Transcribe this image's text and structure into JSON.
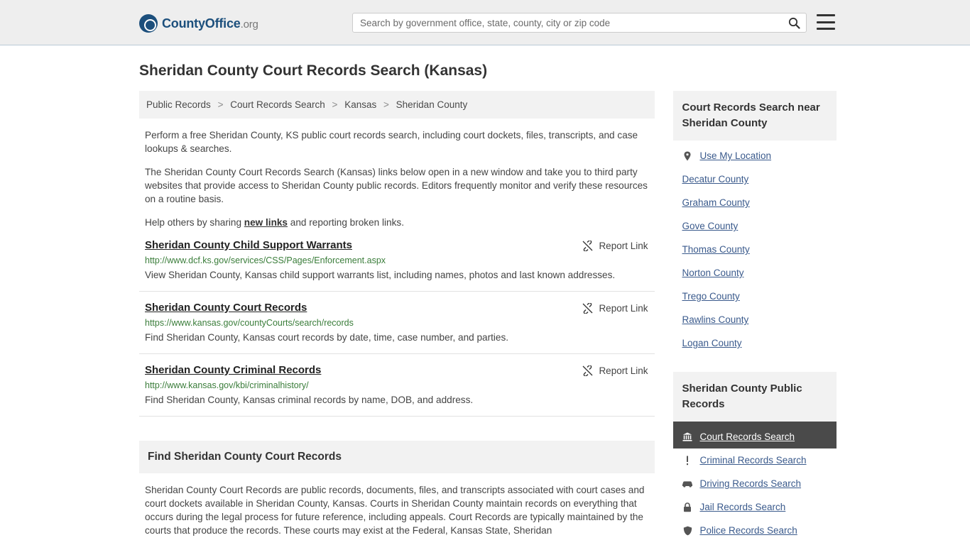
{
  "header": {
    "logo": {
      "county": "County",
      "office": "Office",
      "org": ".org"
    },
    "search": {
      "placeholder": "Search by government office, state, county, city or zip code",
      "value": "",
      "button_label": "search-icon"
    },
    "menu_label": "menu-icon"
  },
  "page_title": "Sheridan County Court Records Search (Kansas)",
  "breadcrumb": [
    "Public Records",
    "Court Records Search",
    "Kansas",
    "Sheridan County"
  ],
  "breadcrumb_separator": ">",
  "intro": {
    "p1": "Perform a free Sheridan County, KS public court records search, including court dockets, files, transcripts, and case lookups & searches.",
    "p2": "The Sheridan County Court Records Search (Kansas) links below open in a new window and take you to third party websites that provide access to Sheridan County public records. Editors frequently monitor and verify these resources on a routine basis.",
    "p3_before": "Help others by sharing ",
    "p3_link": "new links",
    "p3_after": " and reporting broken links."
  },
  "report_link_label": "Report Link",
  "results": [
    {
      "title": "Sheridan County Child Support Warrants",
      "url": "http://www.dcf.ks.gov/services/CSS/Pages/Enforcement.aspx",
      "description": "View Sheridan County, Kansas child support warrants list, including names, photos and last known addresses."
    },
    {
      "title": "Sheridan County Court Records",
      "url": "https://www.kansas.gov/countyCourts/search/records",
      "description": "Find Sheridan County, Kansas court records by date, time, case number, and parties."
    },
    {
      "title": "Sheridan County Criminal Records",
      "url": "http://www.kansas.gov/kbi/criminalhistory/",
      "description": "Find Sheridan County, Kansas criminal records by name, DOB, and address."
    }
  ],
  "find_section": {
    "heading": "Find Sheridan County Court Records",
    "body": "Sheridan County Court Records are public records, documents, files, and transcripts associated with court cases and court dockets available in Sheridan County, Kansas. Courts in Sheridan County maintain records on everything that occurs during the legal process for future reference, including appeals. Court Records are typically maintained by the courts that produce the records. These courts may exist at the Federal, Kansas State, Sheridan"
  },
  "sidebar": {
    "near_box": {
      "title": "Court Records Search near Sheridan County",
      "items": [
        {
          "label": "Use My Location",
          "icon": "location-pin-icon"
        },
        {
          "label": "Decatur County",
          "icon": ""
        },
        {
          "label": "Graham County",
          "icon": ""
        },
        {
          "label": "Gove County",
          "icon": ""
        },
        {
          "label": "Thomas County",
          "icon": ""
        },
        {
          "label": "Norton County",
          "icon": ""
        },
        {
          "label": "Trego County",
          "icon": ""
        },
        {
          "label": "Rawlins County",
          "icon": ""
        },
        {
          "label": "Logan County",
          "icon": ""
        }
      ]
    },
    "public_records_box": {
      "title": "Sheridan County Public Records",
      "items": [
        {
          "label": "Court Records Search",
          "icon": "bank-icon",
          "active": true
        },
        {
          "label": "Criminal Records Search",
          "icon": "exclamation-icon",
          "active": false
        },
        {
          "label": "Driving Records Search",
          "icon": "car-icon",
          "active": false
        },
        {
          "label": "Jail Records Search",
          "icon": "lock-icon",
          "active": false
        },
        {
          "label": "Police Records Search",
          "icon": "shield-icon",
          "active": false
        }
      ]
    }
  },
  "colors": {
    "header_bg": "#eeeeee",
    "link_green": "#3a7d3a",
    "sidebar_link": "#3a5a8c",
    "active_bg": "#4a4a4a",
    "panel_bg": "#f2f2f2"
  }
}
